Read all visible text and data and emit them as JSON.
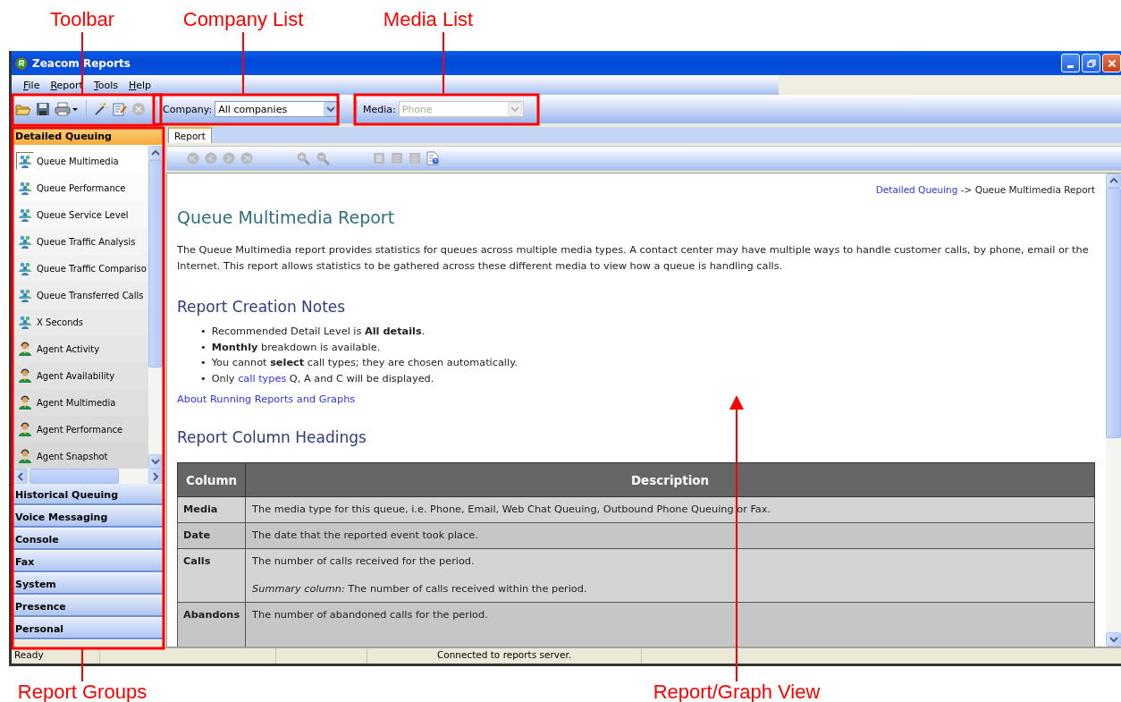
{
  "window": {
    "title": "Zeacom Reports"
  },
  "menu": [
    {
      "label": "File"
    },
    {
      "label": "Report"
    },
    {
      "label": "Tools"
    },
    {
      "label": "Help"
    }
  ],
  "toolbar": {
    "company": {
      "label": "Company:",
      "value": "All companies",
      "disabled": false
    },
    "media": {
      "label": "Media:",
      "value": "Phone",
      "disabled": true
    }
  },
  "sidebar": {
    "groups": [
      {
        "label": "Detailed Queuing",
        "selected": true,
        "items": [
          {
            "label": "Queue Multimedia",
            "kind": "queue",
            "selected": true
          },
          {
            "label": "Queue Performance",
            "kind": "queue",
            "selected": false
          },
          {
            "label": "Queue Service Level",
            "kind": "queue",
            "selected": false
          },
          {
            "label": "Queue Traffic Analysis",
            "kind": "queue",
            "selected": false
          },
          {
            "label": "Queue Traffic Compariso",
            "kind": "queue",
            "selected": false
          },
          {
            "label": "Queue Transferred Calls",
            "kind": "queue",
            "selected": false
          },
          {
            "label": "X Seconds",
            "kind": "queue",
            "selected": false
          },
          {
            "label": "Agent Activity",
            "kind": "agent",
            "selected": false
          },
          {
            "label": "Agent Availability",
            "kind": "agent",
            "selected": false
          },
          {
            "label": "Agent Multimedia",
            "kind": "agent",
            "selected": false
          },
          {
            "label": "Agent Performance",
            "kind": "agent",
            "selected": false
          },
          {
            "label": "Agent Snapshot",
            "kind": "agent",
            "selected": false
          }
        ]
      },
      {
        "label": "Historical Queuing",
        "selected": false
      },
      {
        "label": "Voice Messaging",
        "selected": false
      },
      {
        "label": "Console",
        "selected": false
      },
      {
        "label": "Fax",
        "selected": false
      },
      {
        "label": "System",
        "selected": false
      },
      {
        "label": "Presence",
        "selected": false
      },
      {
        "label": "Personal",
        "selected": false
      }
    ]
  },
  "tabs": [
    {
      "label": "Report",
      "selected": true
    }
  ],
  "report": {
    "breadcrumb": {
      "link": "Detailed Queuing",
      "rest": "-> Queue Multimedia Report"
    },
    "title": "Queue Multimedia Report",
    "intro": "The Queue Multimedia report provides statistics for queues across multiple media types. A contact center may have multiple ways to handle customer calls, by phone, email or the Internet. This report allows statistics to be gathered across these different media to view how a queue is handling calls.",
    "notes_heading": "Report Creation Notes",
    "notes": [
      {
        "bullet": "•",
        "parts": [
          {
            "text": "Recommended Detail Level is **All details**.",
            "link": false
          }
        ]
      },
      {
        "bullet": "•",
        "parts": [
          {
            "text": "**Monthly** breakdown is available.",
            "link": false
          }
        ]
      },
      {
        "bullet": "•",
        "parts": [
          {
            "text": "You cannot **select** call types; they are chosen automatically.",
            "link": false
          }
        ]
      },
      {
        "bullet": "•",
        "parts": [
          {
            "text": "Only ",
            "link": false
          },
          {
            "text": "call types",
            "link": true
          },
          {
            "text": " Q, A and C will be displayed.",
            "link": false
          }
        ]
      }
    ],
    "about_link": "About Running Reports and Graphs",
    "columns_heading": "Report Column Headings",
    "table": {
      "columns": [
        "Column",
        "Description"
      ],
      "rows": [
        {
          "name": "Media",
          "description": "The media type for this queue, i.e. Phone, Email, Web Chat Queuing, Outbound Phone Queuing or Fax."
        },
        {
          "name": "Date",
          "description": "The date that the reported event took place."
        },
        {
          "name": "Calls",
          "description": "The number of calls received for the period.",
          "summary": "*Summary column:* The number of calls received within the period."
        },
        {
          "name": "Abandons",
          "description": "The number of abandoned calls for the period."
        }
      ]
    }
  },
  "status_bar": [
    "Ready",
    "Connected to reports server."
  ],
  "annotations": [
    {
      "label": "Toolbar"
    },
    {
      "label": "Company List"
    },
    {
      "label": "Media List"
    },
    {
      "label": "Report Groups"
    },
    {
      "label": "Report/Graph View"
    }
  ]
}
